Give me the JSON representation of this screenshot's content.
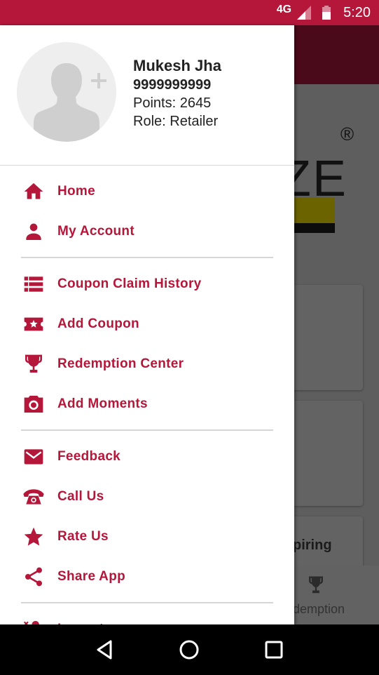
{
  "status_bar": {
    "network": "4G",
    "time": "5:20",
    "color": "#b5173a"
  },
  "profile": {
    "name": "Mukesh Jha",
    "phone": "9999999999",
    "points": "Points: 2645",
    "role": "Role: Retailer",
    "avatar_icon": "add-user-avatar-icon"
  },
  "menu": {
    "accent": "#b5173a",
    "groups": [
      [
        {
          "label": "Home",
          "icon": "home-icon"
        },
        {
          "label": "My Account",
          "icon": "person-icon"
        }
      ],
      [
        {
          "label": "Coupon Claim History",
          "icon": "list-icon"
        },
        {
          "label": "Add Coupon",
          "icon": "ticket-star-icon"
        },
        {
          "label": "Redemption Center",
          "icon": "trophy-icon"
        },
        {
          "label": "Add Moments",
          "icon": "camera-icon"
        }
      ],
      [
        {
          "label": "Feedback",
          "icon": "mail-icon"
        },
        {
          "label": "Call Us",
          "icon": "phone-icon"
        },
        {
          "label": "Rate Us",
          "icon": "star-icon"
        },
        {
          "label": "Share App",
          "icon": "share-icon"
        }
      ],
      [
        {
          "label": "Logout",
          "icon": "logout-user-icon"
        }
      ]
    ]
  },
  "background_app": {
    "logo_fragment": "ZE",
    "registered_mark": "®",
    "card_text_fragment": "piring",
    "bottom_nav_label_fragment": "demption"
  },
  "nav_bar": {
    "back": "back-icon",
    "home": "home-circle-icon",
    "recents": "recents-icon"
  }
}
